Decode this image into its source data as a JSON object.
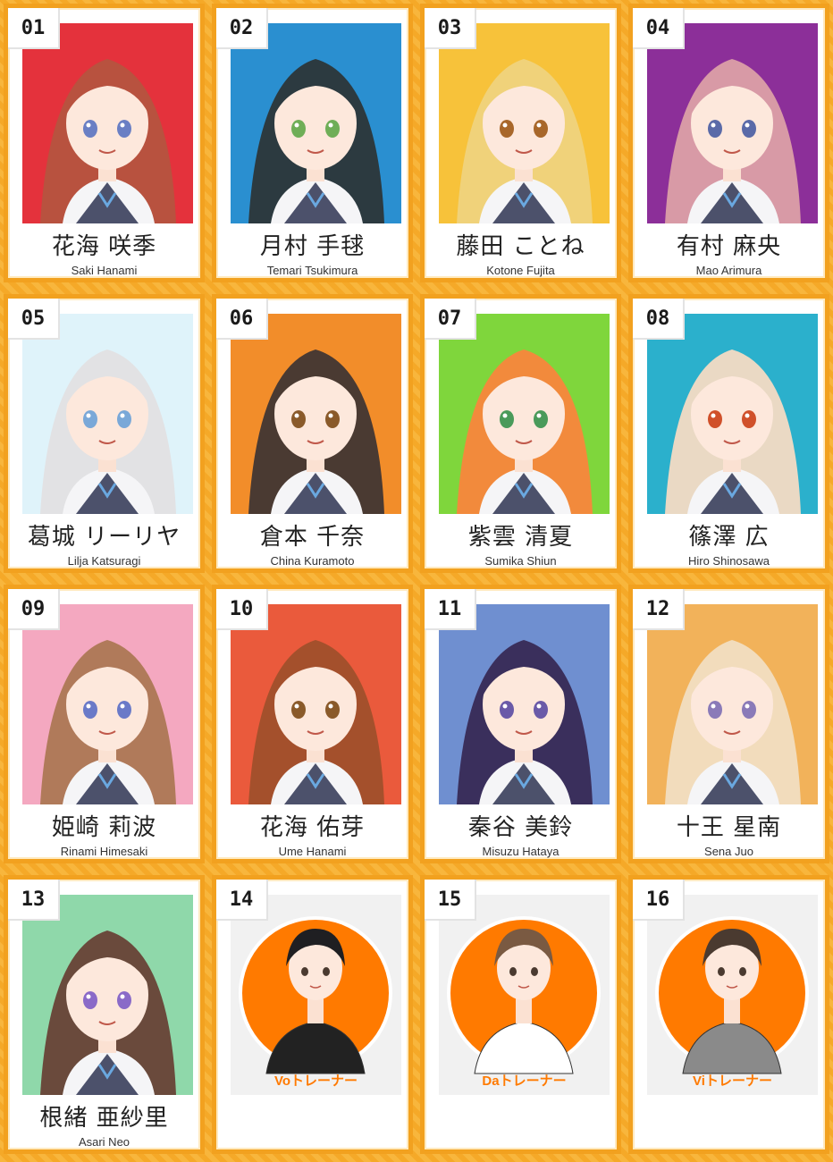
{
  "cards": [
    {
      "num": "01",
      "name_jp": "花海 咲季",
      "name_en": "Saki Hanami",
      "bg": "#e4323c",
      "hair": "#b8523f",
      "eye": "#6a7fc4"
    },
    {
      "num": "02",
      "name_jp": "月村 手毬",
      "name_en": "Temari Tsukimura",
      "bg": "#2a8fd0",
      "hair": "#2c3a40",
      "eye": "#6fae57"
    },
    {
      "num": "03",
      "name_jp": "藤田 ことね",
      "name_en": "Kotone Fujita",
      "bg": "#f7c23a",
      "hair": "#f0d27a",
      "eye": "#a8672a"
    },
    {
      "num": "04",
      "name_jp": "有村 麻央",
      "name_en": "Mao Arimura",
      "bg": "#8c2f99",
      "hair": "#d89aa6",
      "eye": "#5a6aa8"
    },
    {
      "num": "05",
      "name_jp": "葛城 リーリヤ",
      "name_en": "Lilja Katsuragi",
      "bg": "#dff3fa",
      "hair": "#e2e2e4",
      "eye": "#7aa8d8"
    },
    {
      "num": "06",
      "name_jp": "倉本 千奈",
      "name_en": "China Kuramoto",
      "bg": "#f28d2a",
      "hair": "#4a3a32",
      "eye": "#8a5a2a"
    },
    {
      "num": "07",
      "name_jp": "紫雲 清夏",
      "name_en": "Sumika Shiun",
      "bg": "#7fd63c",
      "hair": "#f28a3c",
      "eye": "#4a9a5a"
    },
    {
      "num": "08",
      "name_jp": "篠澤 広",
      "name_en": "Hiro Shinosawa",
      "bg": "#2bb0cc",
      "hair": "#ead9c4",
      "eye": "#d0502a"
    },
    {
      "num": "09",
      "name_jp": "姫崎 莉波",
      "name_en": "Rinami Himesaki",
      "bg": "#f4a8c0",
      "hair": "#b07a5a",
      "eye": "#6a7ac8"
    },
    {
      "num": "10",
      "name_jp": "花海 佑芽",
      "name_en": "Ume Hanami",
      "bg": "#ea5a3c",
      "hair": "#a4502c",
      "eye": "#8a5a2a"
    },
    {
      "num": "11",
      "name_jp": "秦谷 美鈴",
      "name_en": "Misuzu Hataya",
      "bg": "#6f8fd0",
      "hair": "#3a2f5c",
      "eye": "#6a5aa8"
    },
    {
      "num": "12",
      "name_jp": "十王 星南",
      "name_en": "Sena Juo",
      "bg": "#f2b25a",
      "hair": "#f2dcbc",
      "eye": "#8a7ab8"
    },
    {
      "num": "13",
      "name_jp": "根緒 亜紗里",
      "name_en": "Asari Neo",
      "bg": "#8fd8aa",
      "hair": "#6a4a3c",
      "eye": "#8a6ac8"
    }
  ],
  "trainers": [
    {
      "num": "14",
      "label": "Voトレーナー",
      "hair": "#1f1f22",
      "shirt": "#222222"
    },
    {
      "num": "15",
      "label": "Daトレーナー",
      "hair": "#7a5a42",
      "shirt": "#ffffff"
    },
    {
      "num": "16",
      "label": "Viトレーナー",
      "hair": "#4a3a30",
      "shirt": "#8a8a8a"
    }
  ],
  "colors": {
    "frame": "#f2a11f",
    "trainer_accent": "#ff7a00"
  }
}
